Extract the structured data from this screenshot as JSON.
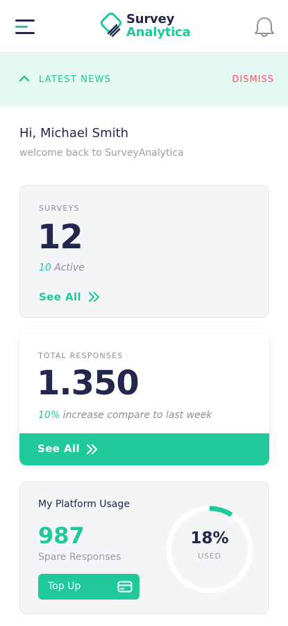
{
  "header": {
    "logo_line1": "Survey",
    "logo_line2": "Analytica",
    "menu_icon": "hamburger-icon",
    "notification_icon": "bell-icon"
  },
  "news": {
    "label": "LATEST NEWS",
    "dismiss": "DISMISS"
  },
  "greeting": {
    "title": "Hi, Michael Smith",
    "subtitle": "welcome back to SurveyAnalytica"
  },
  "surveys": {
    "label": "SURVEYS",
    "count": "12",
    "active_value": "10",
    "active_text": "Active",
    "see_all": "See All"
  },
  "responses": {
    "label": "TOTAL RESPONSES",
    "count": "1.350",
    "change_value": "10%",
    "change_text": "increase compare to last week",
    "see_all": "See All"
  },
  "usage": {
    "title": "My Platform Usage",
    "spare_count": "987",
    "spare_label": "Spare Responses",
    "topup_label": "Top Up",
    "percent_label": "18%",
    "percent_value": 0.18,
    "used_label": "USED"
  },
  "colors": {
    "accent": "#1fc99a",
    "navy": "#23264d",
    "dismiss": "#ff4d6d",
    "news_bg": "#e4f8f1"
  }
}
